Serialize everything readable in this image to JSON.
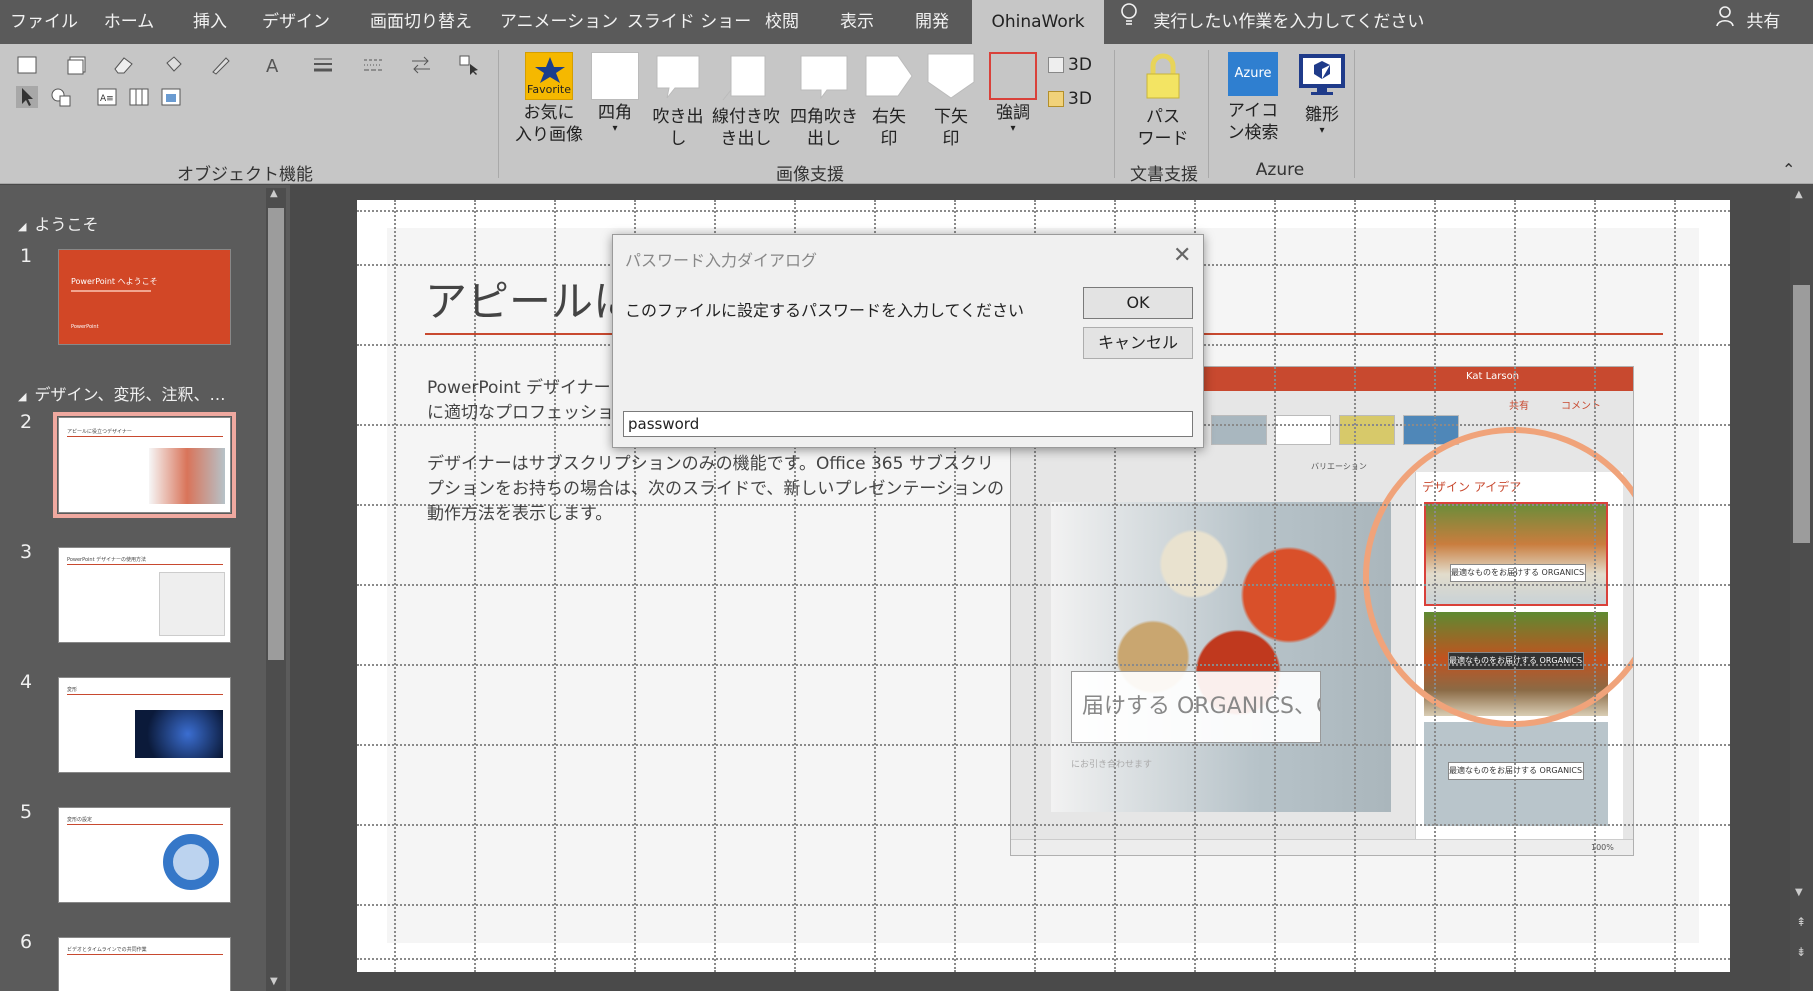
{
  "tabs": [
    {
      "label": "ファイル"
    },
    {
      "label": "ホーム"
    },
    {
      "label": "挿入"
    },
    {
      "label": "デザイン"
    },
    {
      "label": "画面切り替え"
    },
    {
      "label": "アニメーション"
    },
    {
      "label": "スライド ショー"
    },
    {
      "label": "校閲"
    },
    {
      "label": "表示"
    },
    {
      "label": "開発"
    },
    {
      "label": "OhinaWork"
    }
  ],
  "tell_me": "実行したい作業を入力してください",
  "share": "共有",
  "ribbon": {
    "groups": {
      "object": "オブジェクト機能",
      "image": "画像支援",
      "doc": "文書支援",
      "azure": "Azure"
    },
    "buttons": {
      "favorite": "お気に\n入り画像",
      "favorite_icon_text": "Favorite",
      "square": "四角",
      "callout": "吹き出\nし",
      "line_callout": "線付き吹\nき出し",
      "rect_callout": "四角吹き\n出し",
      "right_arrow": "右矢\n印",
      "down_arrow": "下矢\n印",
      "emphasis": "強調",
      "d3a": "3D",
      "d3b": "3D",
      "password": "パス\nワード",
      "icon_search": "アイコ\nン検索",
      "icon_search_badge": "Azure",
      "template": "雛形"
    }
  },
  "slides_pane": {
    "sections": [
      {
        "label": "ようこそ"
      },
      {
        "label": "デザイン、変形、注釈、…"
      }
    ],
    "slides": [
      {
        "num": "1",
        "title": "PowerPoint へようこそ",
        "sub": "PowerPoint"
      },
      {
        "num": "2",
        "title": "アピールに役立つデザイナー"
      },
      {
        "num": "3",
        "title": "PowerPoint デザイナーの使用方法"
      },
      {
        "num": "4",
        "title": "変形"
      },
      {
        "num": "5",
        "title": "変形の設定"
      },
      {
        "num": "6",
        "title": "ビデオとタイムラインでの共同作業"
      }
    ]
  },
  "slide": {
    "title": "アピールに役",
    "para1_line1": "PowerPoint デザイナーは、",
    "para1_line2": "に適切なプロフェッショナルな",
    "para2_line1": "デザイナーはサブスクリプションのみの機能です。Office 365 サブスクリ",
    "para2_line2": "プションをお持ちの場合は、次のスライドで、新しいプレゼンテーションの",
    "para2_line3": "動作方法を表示します。"
  },
  "embedded_screenshot": {
    "user": "Kat Larson",
    "share": "共有",
    "comment": "コメント",
    "variation": "バリエーション",
    "design_ideas": "デザイン アイデア",
    "banner": "届けする ORGANICS、CO.",
    "banner_sub": "にお引き合わせます",
    "card1": "最適なものをお届けする ORGANICS、CO.",
    "card2": "最適なものをお届けする ORGANICS、CO.",
    "card3": "最適なものをお届けする ORGANICS、CO.",
    "zoom": "100%"
  },
  "dialog": {
    "title": "パスワード入力ダイアログ",
    "prompt": "このファイルに設定するパスワードを入力してください",
    "ok": "OK",
    "cancel": "キャンセル",
    "input_value": "password"
  },
  "colors": {
    "accent": "#c8492f",
    "ribbon": "#c6c6c6",
    "tabbar": "#5a5a5a"
  }
}
